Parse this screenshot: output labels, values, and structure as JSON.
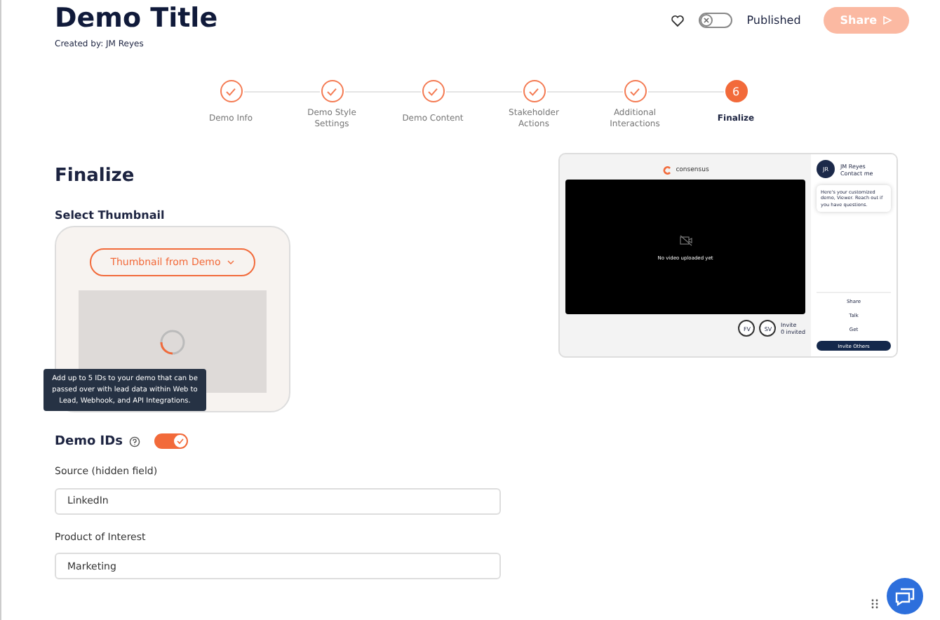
{
  "header": {
    "title": "Demo Title",
    "created_by": "Created by: JM Reyes",
    "published": {
      "label": "Published",
      "on": false
    },
    "share_button": "Share"
  },
  "steps": [
    {
      "label": "Demo Info",
      "done": true
    },
    {
      "label": "Demo Style Settings",
      "done": true
    },
    {
      "label": "Demo Content",
      "done": true
    },
    {
      "label": "Stakeholder Actions",
      "done": true
    },
    {
      "label": "Additional Interactions",
      "done": true
    },
    {
      "label": "Finalize",
      "done": false,
      "number": "6"
    }
  ],
  "section_title": "Finalize",
  "thumbnail": {
    "label": "Select Thumbnail",
    "dropdown": "Thumbnail from Demo"
  },
  "tooltip": "Add up to 5 IDs to your demo that can be passed over with lead data within Web to Lead, Webhook, and API Integrations.",
  "demo_ids": {
    "label": "Demo IDs",
    "on": true
  },
  "fields": [
    {
      "label": "Source (hidden field)",
      "value": "LinkedIn"
    },
    {
      "label": "Product of Interest",
      "value": "Marketing"
    }
  ],
  "preview": {
    "brand": "consensus",
    "video_message": "No video uploaded yet",
    "avatar": "JR",
    "name": "JM Reyes",
    "contact": "Contact me",
    "message": "Here's your customized demo, Viewer. Reach out if you have questions.",
    "actions": [
      "Share",
      "Talk",
      "Get"
    ],
    "invite_button": "Invite Others",
    "viewers": [
      "FV",
      "SV"
    ],
    "invite_label": "Invite",
    "invited": "0 invited"
  }
}
